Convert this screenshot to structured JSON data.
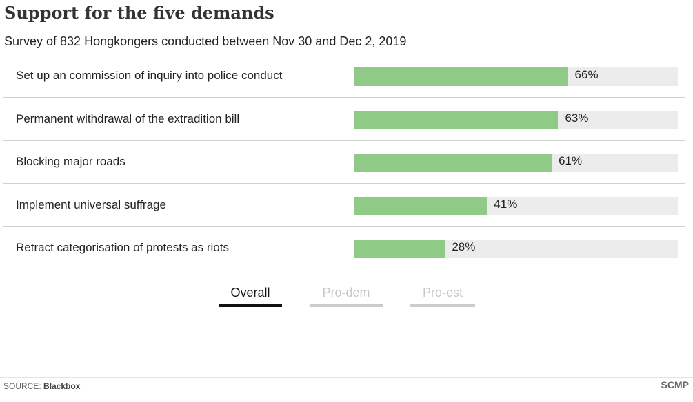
{
  "header": {
    "title": "Support for the five demands",
    "subtitle": "Survey of 832 Hongkongers conducted between Nov 30 and Dec 2, 2019"
  },
  "chart_data": {
    "type": "bar",
    "orientation": "horizontal",
    "categories": [
      "Set up an commission of inquiry into police conduct",
      "Permanent withdrawal of the extradition bill",
      "Blocking major roads",
      "Implement universal suffrage",
      "Retract categorisation of protests as riots"
    ],
    "values": [
      66,
      63,
      61,
      41,
      28
    ],
    "value_labels": [
      "66%",
      "63%",
      "61%",
      "41%",
      "28%"
    ],
    "xlim": [
      0,
      100
    ],
    "unit": "%",
    "grid": false,
    "colors": {
      "bar": "#8fcb86",
      "track": "#ececec"
    }
  },
  "tabs": [
    {
      "label": "Overall",
      "active": true
    },
    {
      "label": "Pro-dem",
      "active": false
    },
    {
      "label": "Pro-est",
      "active": false
    }
  ],
  "footer": {
    "source_prefix": "SOURCE:",
    "source_name": "Blackbox",
    "brand": "SCMP"
  }
}
